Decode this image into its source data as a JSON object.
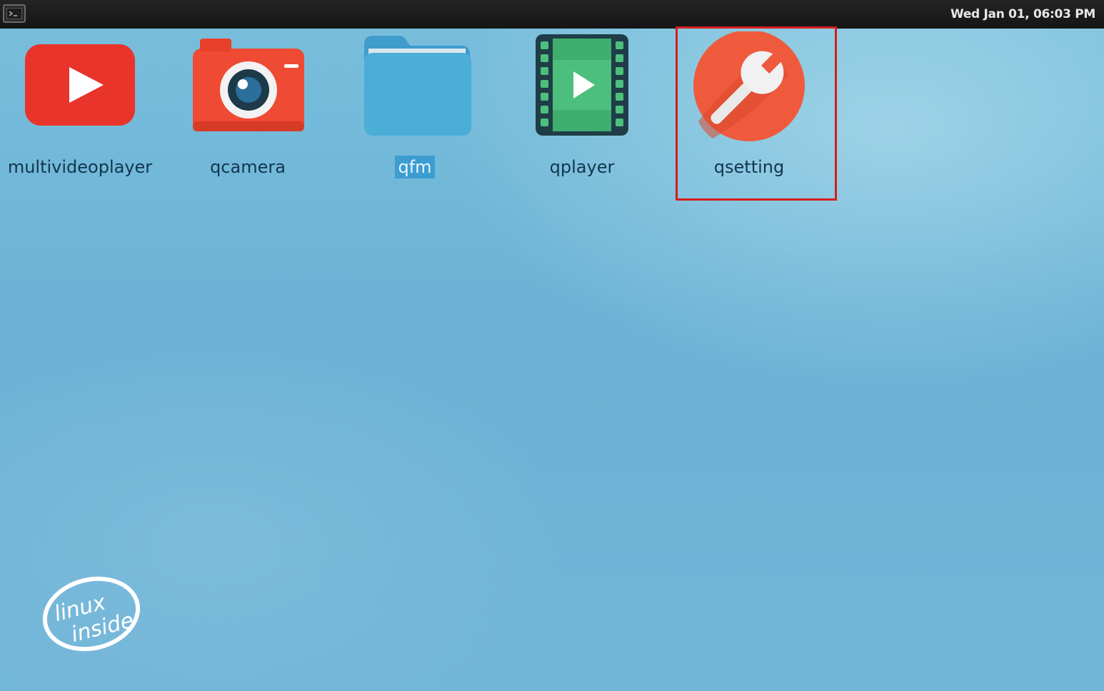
{
  "topbar": {
    "clock": "Wed Jan 01, 06:03 PM",
    "terminal_icon": "terminal-icon"
  },
  "apps": [
    {
      "label": "multivideoplayer",
      "icon": "youtube-play-icon",
      "color": "#e8342a"
    },
    {
      "label": "qcamera",
      "icon": "camera-icon",
      "color": "#ef4a33"
    },
    {
      "label": "qfm",
      "icon": "folder-icon",
      "color": "#4aaed6",
      "selected": true
    },
    {
      "label": "qplayer",
      "icon": "film-play-icon",
      "color": "#3fae6e"
    },
    {
      "label": "qsetting",
      "icon": "wrench-icon",
      "color": "#ef5a3c",
      "highlighted": true
    }
  ],
  "logo": {
    "line1": "linux",
    "line2": "inside"
  }
}
